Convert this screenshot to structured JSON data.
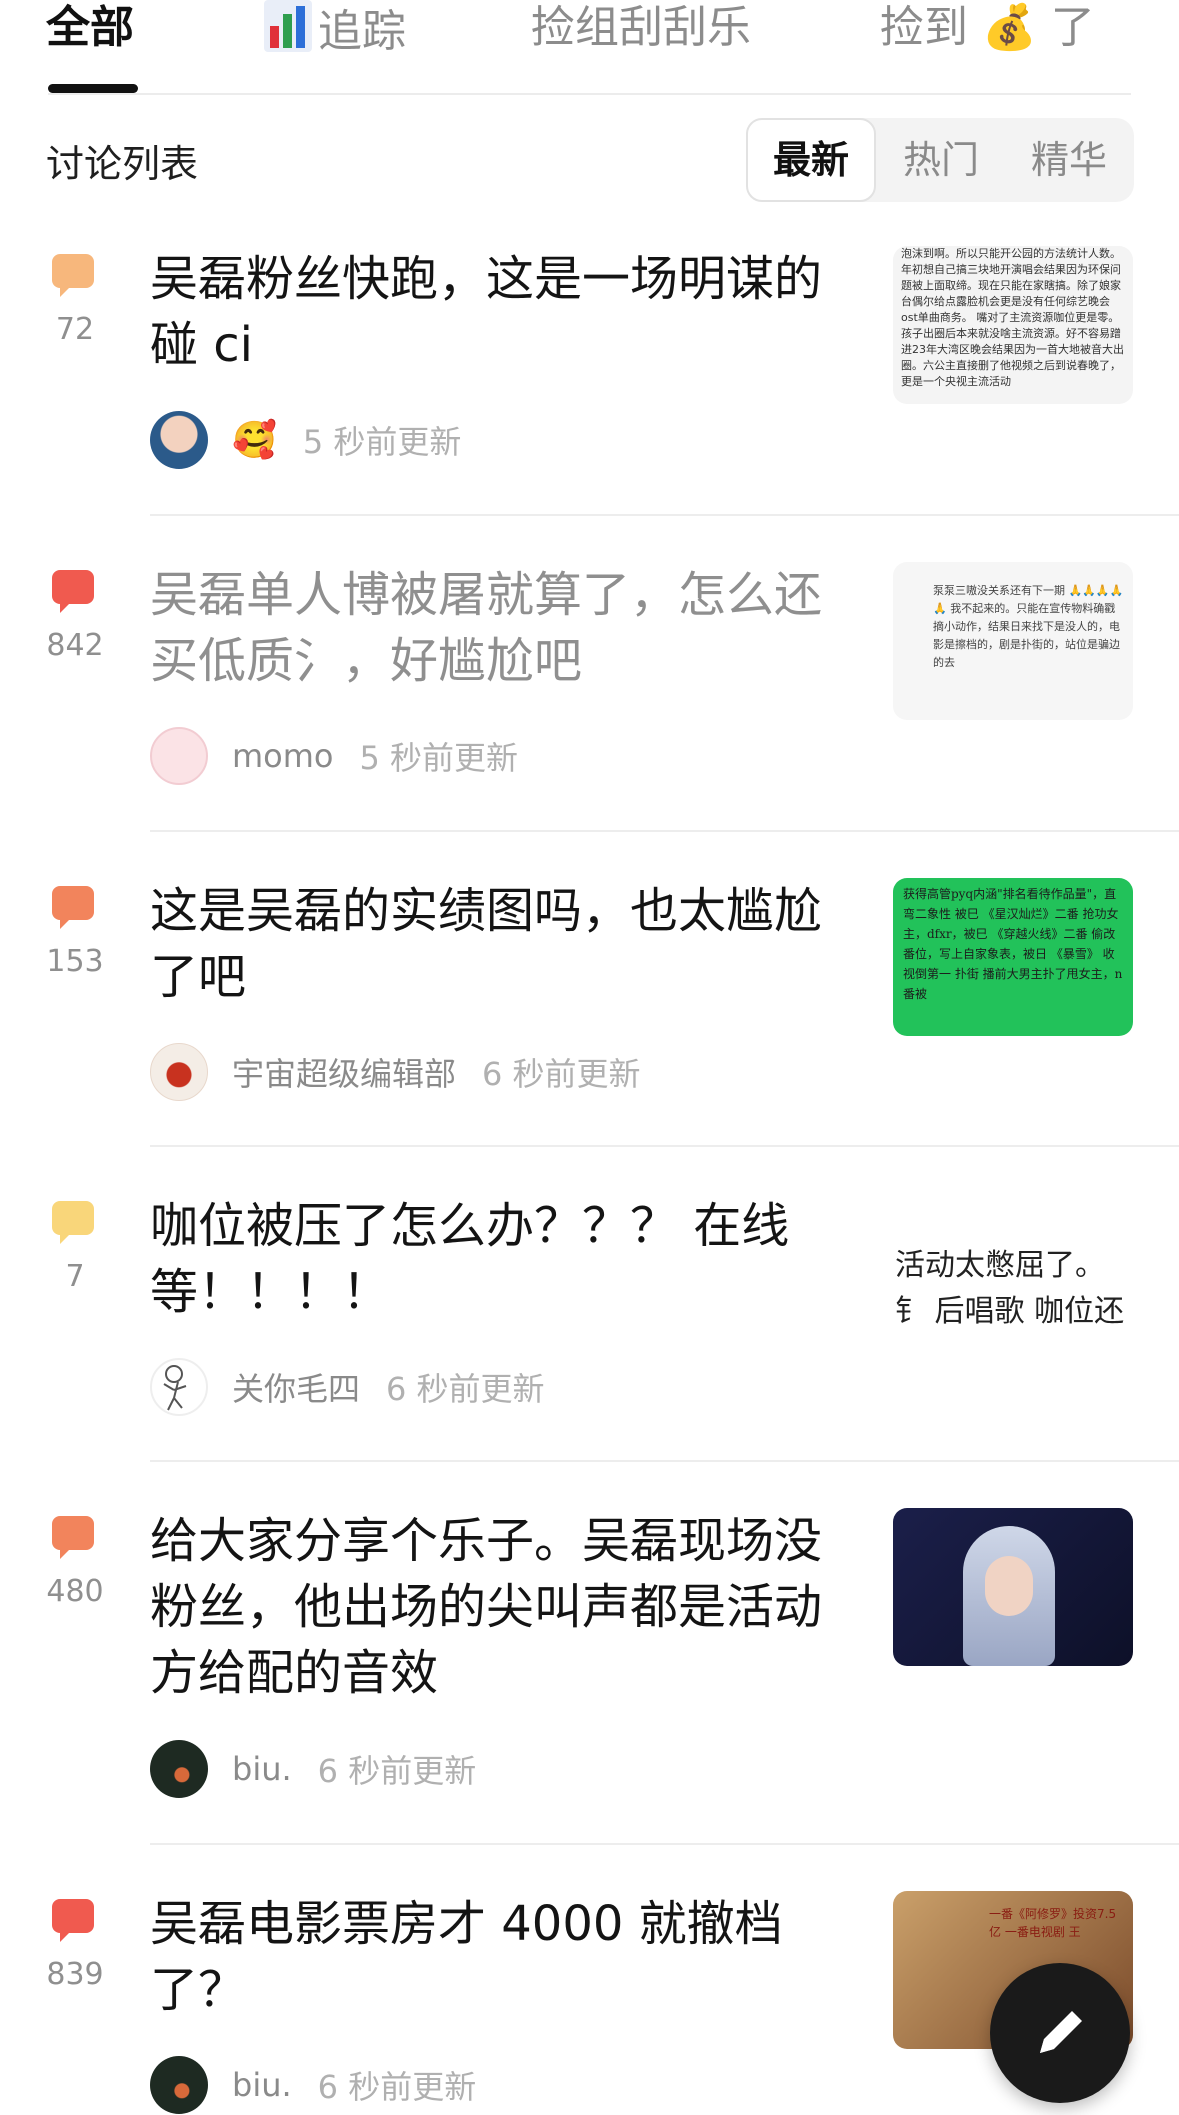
{
  "tabs": [
    {
      "label": "全部",
      "active": true
    },
    {
      "label": "追踪",
      "icon": "bar-chart-icon"
    },
    {
      "label": "捡组刮刮乐"
    },
    {
      "label_before": "捡到",
      "icon": "money-bag-icon",
      "label_after": "了"
    }
  ],
  "section": {
    "title": "讨论列表",
    "sort_options": [
      "最新",
      "热门",
      "精华"
    ],
    "sort_selected": "最新"
  },
  "posts": [
    {
      "count": "72",
      "bubble_color": "#f7b77c",
      "title": "吴磊粉丝快跑，这是一场明谋的碰 ci",
      "author": "",
      "author_emoji": "🥰",
      "time": "5 秒前更新",
      "thumb_text": "泡沫到啊。所以只能开公园的方法统计人数。年初想自己搞三块地开演唱会结果因为环保问题被上面取缔。现在只能在家瞎搞。除了娘家台偶尔给点露脸机会更是没有任何综艺晚会ost单曲商务。 嘴对了主流资源咖位更是零。孩子出圈后本来就没啥主流资源。好不容易蹭进23年大湾区晚会结果因为一首大地被音大出圈。六公主直接删了他视频之后到说春晚了，更是一个央视主流活动"
    },
    {
      "count": "842",
      "bubble_color": "#f05a4f",
      "read": true,
      "title": "吴磊单人博被屠就算了，怎么还买低质氵，好尴尬吧",
      "author": "momo",
      "time": "5 秒前更新",
      "thumb_text": "泵泵三嗷没关系还有下一期 🙏🙏🙏🙏🙏 我不起来的。只能在宣传物料确戳摘小动作，结果日来找下是没人的，电影是擦档的，剧是扑街的，站位是骗边的去"
    },
    {
      "count": "153",
      "bubble_color": "#f2845c",
      "title": "这是吴磊的实绩图吗，也太尴尬了吧",
      "author": "宇宙超级编辑部",
      "time": "6 秒前更新",
      "thumb_text": "获得高管pyq内涵\"排名看待作品量\"，直弯二象性 被巳 《星汉灿烂》二番 抢功女主，dfxr，被巳 《穿越火线》二番 偷改番位，写上自家象表，被日 《暴雪》 收视倒第一 扑街 播前大男主扑了甩女主，n番被"
    },
    {
      "count": "7",
      "bubble_color": "#f9d67a",
      "title": "咖位被压了怎么办？？？ 在线等！！！！",
      "author": "关你毛四",
      "time": "6 秒前更新",
      "thumb_text": "活动太憋屈了。钅 后唱歌 咖位还一"
    },
    {
      "count": "480",
      "bubble_color": "#f2845c",
      "title": "给大家分享个乐子。吴磊现场没粉丝，他出场的尖叫声都是活动方给配的音效",
      "author": "biu.",
      "time": "6 秒前更新"
    },
    {
      "count": "839",
      "bubble_color": "#f05a4f",
      "title": "吴磊电影票房才 4000 就撤档了？",
      "author": "biu.",
      "time": "6 秒前更新",
      "thumb_text": "一番《阿修罗》投资7.5亿 一番电视剧 王"
    }
  ]
}
